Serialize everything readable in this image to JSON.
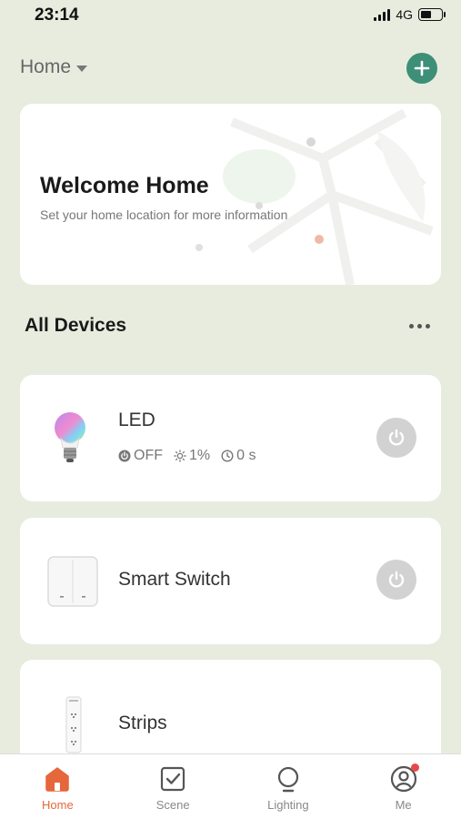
{
  "status_bar": {
    "time": "23:14",
    "network": "4G",
    "battery_level": 0.45
  },
  "header": {
    "home_title": "Home",
    "accent_color": "#3e8f78"
  },
  "welcome": {
    "title": "Welcome Home",
    "subtitle": "Set your home location for more information"
  },
  "devices_section": {
    "title": "All Devices"
  },
  "devices": [
    {
      "name": "LED",
      "icon": "light-bulb-icon",
      "status": {
        "power": "OFF",
        "brightness": "1%",
        "timer": "0 s"
      }
    },
    {
      "name": "Smart Switch",
      "icon": "wall-switch-icon"
    },
    {
      "name": "Strips",
      "icon": "power-strip-icon"
    }
  ],
  "nav": {
    "active_color": "#e5673b",
    "items": [
      {
        "label": "Home",
        "icon": "home-icon",
        "active": true
      },
      {
        "label": "Scene",
        "icon": "checkbox-icon",
        "active": false
      },
      {
        "label": "Lighting",
        "icon": "bulb-outline-icon",
        "active": false
      },
      {
        "label": "Me",
        "icon": "user-icon",
        "active": false,
        "badge": true
      }
    ]
  }
}
